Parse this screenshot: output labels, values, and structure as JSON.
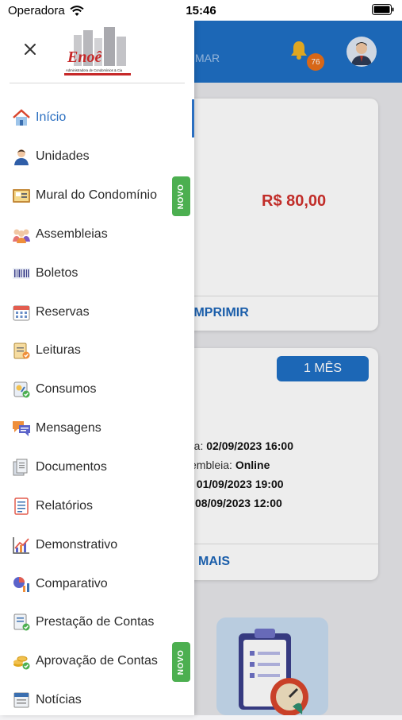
{
  "status_bar": {
    "carrier": "Operadora",
    "time": "15:46"
  },
  "background": {
    "header_text": "MAR",
    "notification_count": "76",
    "card1": {
      "amount": "R$ 80,00",
      "action": "IMPRIMIR"
    },
    "card2": {
      "pill": "1 MÊS",
      "lines": [
        {
          "label": "ra:",
          "value": "02/09/2023 16:00"
        },
        {
          "label": "embleia:",
          "value": "Online"
        },
        {
          "label": ":",
          "value": "01/09/2023 19:00"
        },
        {
          "label": "",
          "value": "08/09/2023 12:00"
        }
      ],
      "action": "MAIS"
    }
  },
  "drawer": {
    "logo_text": "Enoê",
    "logo_subtitle": "Administradora de Condomínios & Cia",
    "menu": [
      {
        "label": "Início",
        "icon": "home-icon",
        "active": true
      },
      {
        "label": "Unidades",
        "icon": "person-icon"
      },
      {
        "label": "Mural do Condomínio",
        "icon": "bulletin-board-icon",
        "badge": "NOVO"
      },
      {
        "label": "Assembleias",
        "icon": "people-group-icon"
      },
      {
        "label": "Boletos",
        "icon": "barcode-icon"
      },
      {
        "label": "Reservas",
        "icon": "calendar-icon"
      },
      {
        "label": "Leituras",
        "icon": "clipboard-check-icon"
      },
      {
        "label": "Consumos",
        "icon": "meter-icon"
      },
      {
        "label": "Mensagens",
        "icon": "chat-bubbles-icon"
      },
      {
        "label": "Documentos",
        "icon": "documents-icon"
      },
      {
        "label": "Relatórios",
        "icon": "report-icon"
      },
      {
        "label": "Demonstrativo",
        "icon": "line-chart-icon"
      },
      {
        "label": "Comparativo",
        "icon": "pie-bar-chart-icon"
      },
      {
        "label": "Prestação de Contas",
        "icon": "accounts-check-icon"
      },
      {
        "label": "Aprovação de Contas",
        "icon": "coins-check-icon",
        "badge": "NOVO"
      },
      {
        "label": "Notícias",
        "icon": "newspaper-icon"
      }
    ]
  },
  "colors": {
    "primary": "#1f6fc4",
    "active": "#2a6fc1",
    "amount": "#d0312d",
    "badge_green": "#4caf50",
    "notification": "#e86f1a"
  }
}
